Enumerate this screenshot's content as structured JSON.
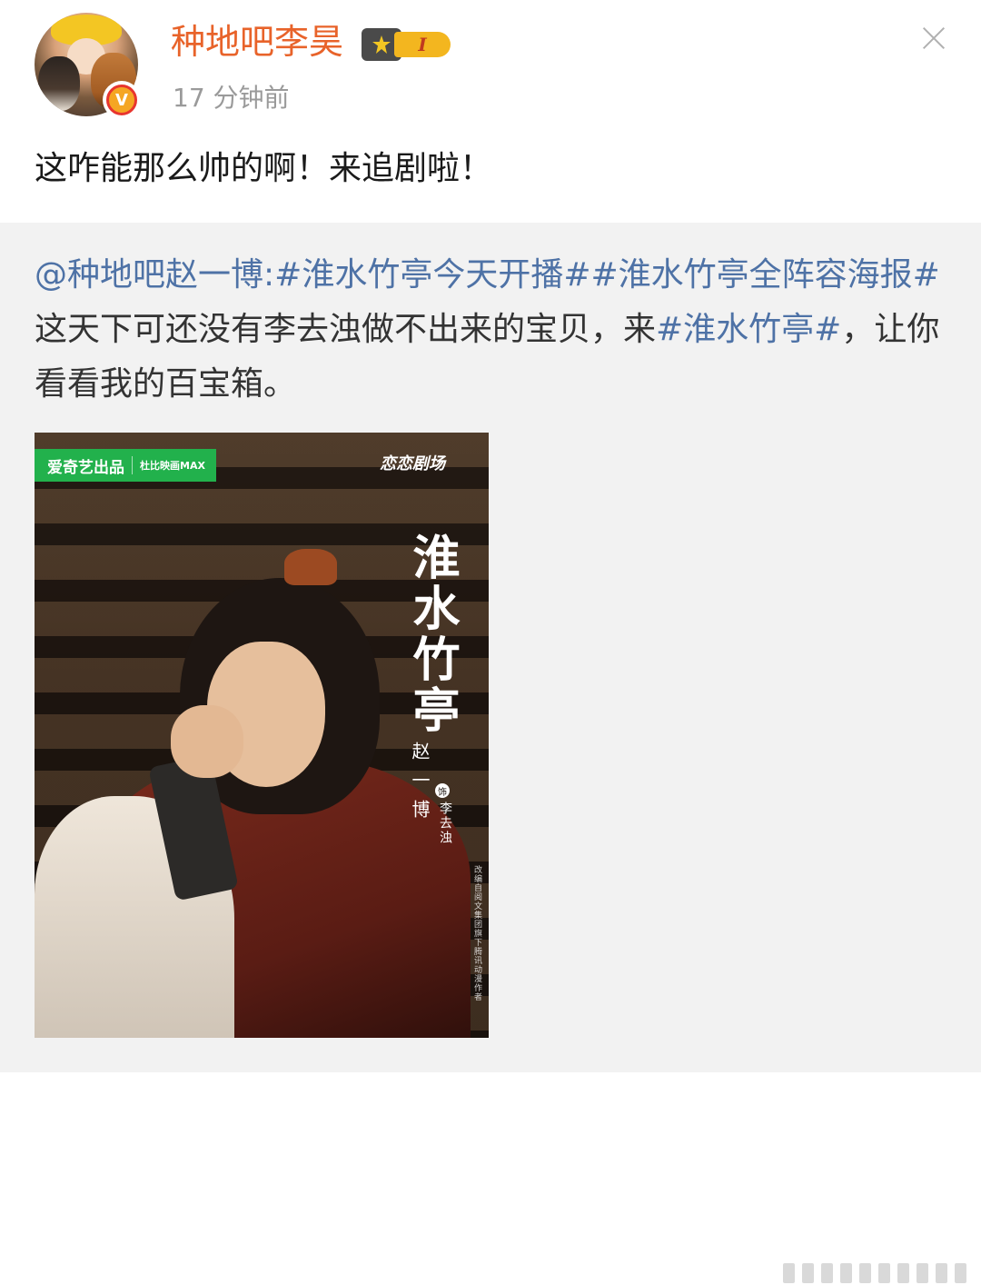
{
  "post": {
    "username": "种地吧李昊",
    "level": "I",
    "timestamp": "17 分钟前",
    "verified_mark": "V",
    "text": "这咋能那么帅的啊！来追剧啦！"
  },
  "repost": {
    "author_link": "@种地吧赵一博",
    "separator": ":",
    "tag1": "#淮水竹亭今天开播#",
    "tag2": "#淮水竹亭全阵容海报#",
    "text1": " 这天下可还没有李去浊做不出来的宝贝，来",
    "tag3": "#淮水竹亭#",
    "text2": "，让你看看我的百宝箱。"
  },
  "poster": {
    "badge_left": "爱奇艺出品",
    "badge_right": "杜比映画MAX",
    "badge_brand": "恋恋剧场",
    "title": "淮水竹亭",
    "actor": "赵一博",
    "role_mark": "饰",
    "role": "李去浊",
    "credit": "改编自阅文集团旗下腾讯动漫作者"
  },
  "icons": {
    "close": "close-icon",
    "crown": "crown-icon",
    "verified": "verified-icon"
  },
  "colors": {
    "username": "#e8632a",
    "link": "#4e72a6",
    "level_badge": "#f3b61f",
    "repost_background": "#f2f2f2"
  }
}
